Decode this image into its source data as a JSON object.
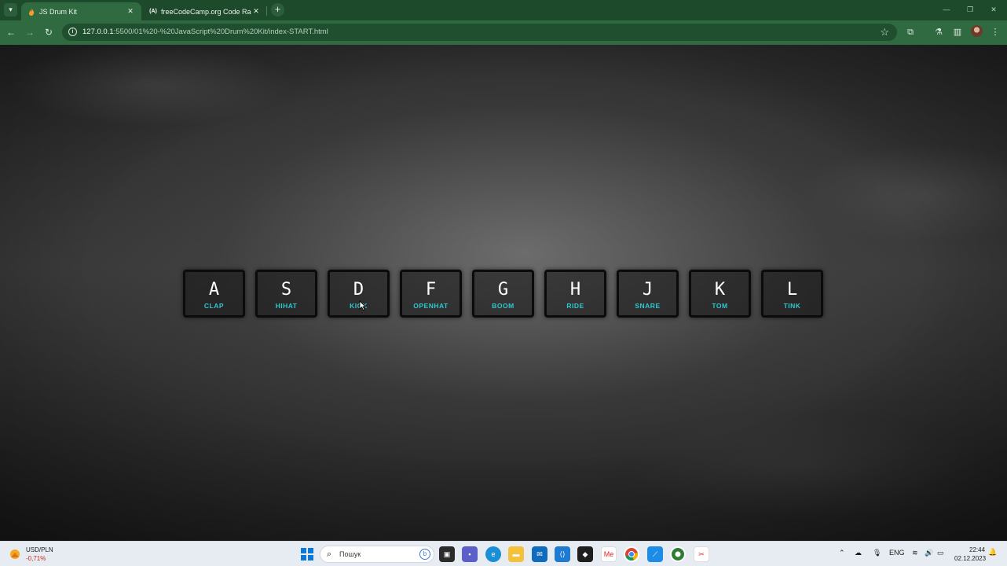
{
  "browser": {
    "tabs": [
      {
        "title": "JS Drum Kit",
        "favicon": "fire-icon",
        "active": true
      },
      {
        "title": "freeCodeCamp.org Code Radio",
        "favicon": "fcc-icon",
        "active": false
      }
    ],
    "url_host": "127.0.0.1",
    "url_rest": ":5500/01%20-%20JavaScript%20Drum%20Kit/index-START.html"
  },
  "keys": [
    {
      "key": "A",
      "sound": "CLAP"
    },
    {
      "key": "S",
      "sound": "HIHAT"
    },
    {
      "key": "D",
      "sound": "KICK"
    },
    {
      "key": "F",
      "sound": "OPENHAT"
    },
    {
      "key": "G",
      "sound": "BOOM"
    },
    {
      "key": "H",
      "sound": "RIDE"
    },
    {
      "key": "J",
      "sound": "SNARE"
    },
    {
      "key": "K",
      "sound": "TOM"
    },
    {
      "key": "L",
      "sound": "TINK"
    }
  ],
  "taskbar": {
    "widget_title": "USD/PLN",
    "widget_value": "-0,71%",
    "search_placeholder": "Пошук",
    "lang": "ENG",
    "time": "22:44",
    "date": "02.12.2023"
  },
  "colors": {
    "accent_sound": "#31c7cf",
    "chrome_green": "#2f6a40"
  }
}
